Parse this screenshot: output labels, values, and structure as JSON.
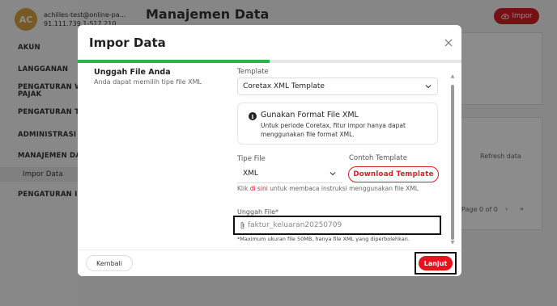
{
  "app": {
    "user": {
      "initials": "AC",
      "email": "achilles-test@online-pa...",
      "ip": "91.111.739.1-517.210"
    },
    "page_title": "Manajemen Data",
    "impor_button": "Impor",
    "sidebar": {
      "items": [
        {
          "label": "AKUN"
        },
        {
          "label": "LANGGANAN"
        },
        {
          "label": "PENGATURAN WA..."
        },
        {
          "label": "PAJAK"
        },
        {
          "label": "PENGATURAN TRA..."
        },
        {
          "label": "ADMINISTRASI"
        },
        {
          "label": "MANAJEMEN DATA"
        },
        {
          "label": "Impor Data"
        },
        {
          "label": "PENGATURAN INT..."
        }
      ]
    },
    "background": {
      "refresh_label": "Refresh data",
      "page_label": "Page 0 of 0"
    }
  },
  "modal": {
    "title": "Impor Data",
    "progress": 0.5,
    "step": {
      "title": "Unggah File Anda",
      "subtitle": "Anda dapat memilih tipe file XML"
    },
    "template": {
      "label": "Template",
      "value": "Coretax XML Template"
    },
    "info": {
      "title": "Gunakan Format File XML",
      "desc": "Untuk periode Coretax, fitur impor hanya dapat menggunakan file format XML."
    },
    "file_type": {
      "label": "Tipe File",
      "value": "XML"
    },
    "sample": {
      "label": "Contoh Template",
      "button": "Download Template"
    },
    "hint": {
      "prefix": "Klik ",
      "link": "di sini",
      "suffix": " untuk membaca instruksi menggunakan file XML"
    },
    "upload": {
      "label": "Unggah File*",
      "value": "faktur_keluaran20250709",
      "note": "*Maximum ukuran file 50MB, hanya file XML yang diperbolehkan."
    },
    "footer": {
      "back": "Kembali",
      "next": "Lanjut"
    }
  },
  "colors": {
    "accent": "#d61f26",
    "progress": "#2db24a"
  }
}
